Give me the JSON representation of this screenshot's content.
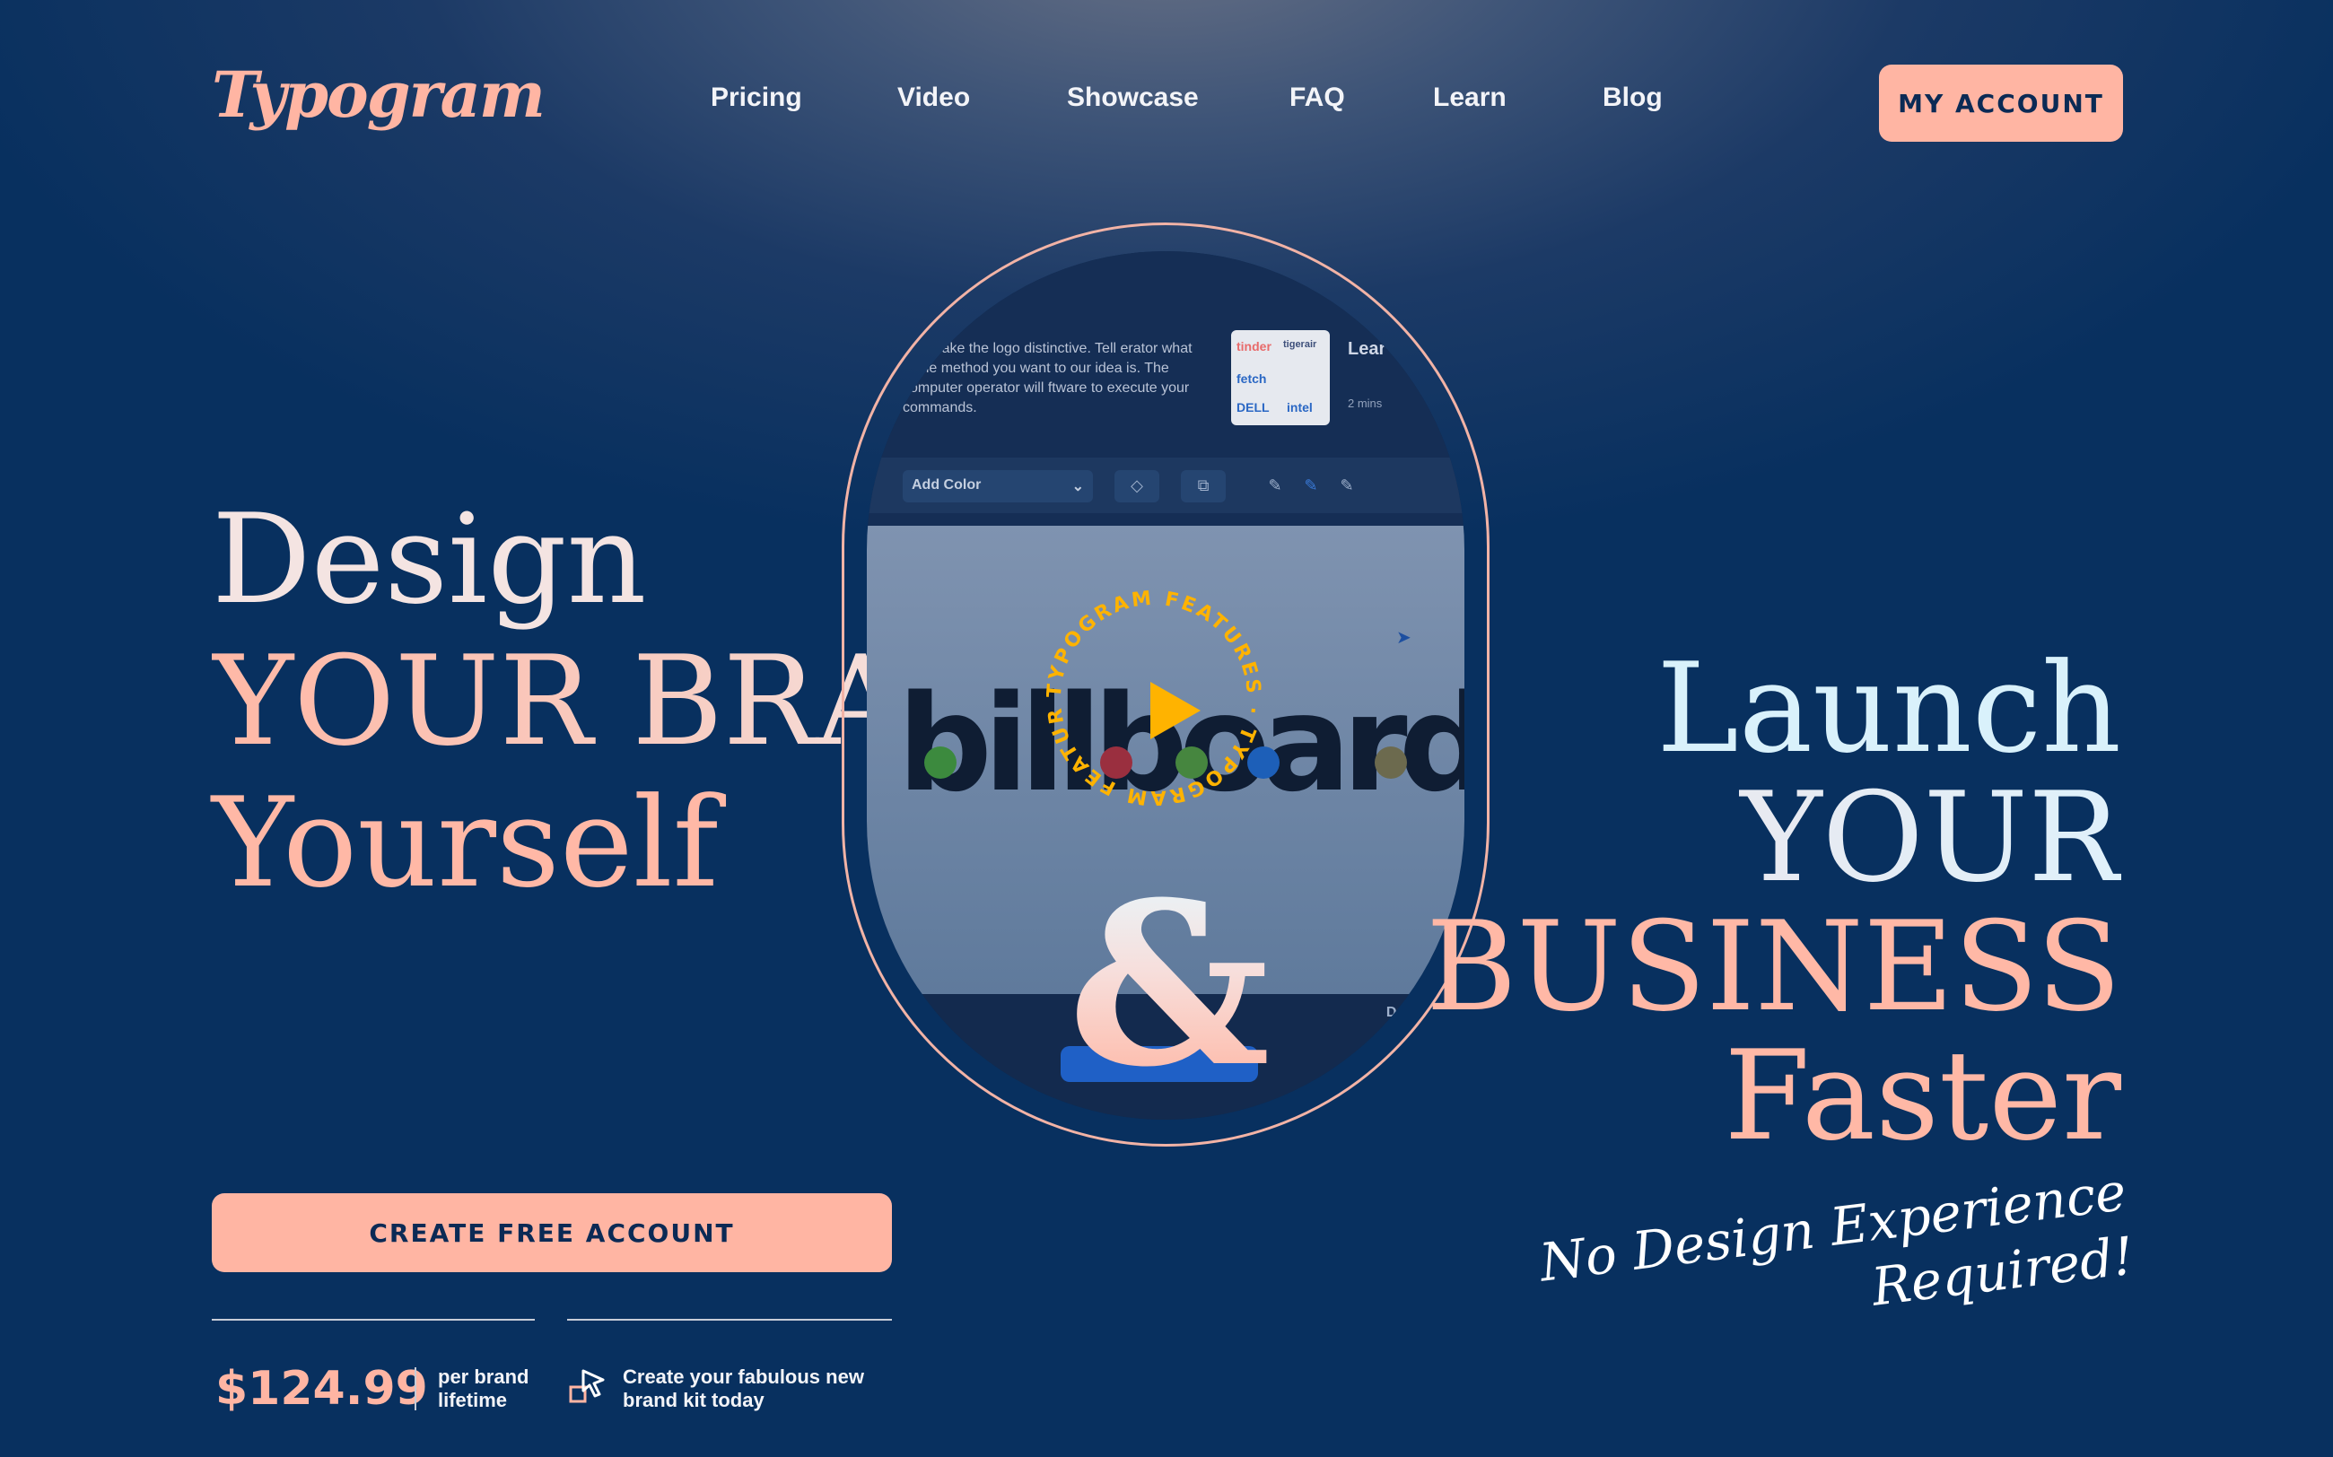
{
  "header": {
    "logo": "Typogram",
    "nav": [
      "Pricing",
      "Video",
      "Showcase",
      "FAQ",
      "Learn",
      "Blog"
    ],
    "account_button": "MY ACCOUNT"
  },
  "hero_left": {
    "line1": "Design",
    "line2": "YOUR BRAND",
    "line3": "Yourself"
  },
  "hero_right": {
    "line1": "Launch",
    "line2": "YOUR",
    "line3": "BUSINESS",
    "line4": "Faster",
    "tagline1": "No Design Experience",
    "tagline2": "Required!"
  },
  "video_preview": {
    "description": "s to make the logo distinctive. Tell erator what is the method you want to our idea is. The computer operator will ftware to execute your commands.",
    "thumb_brands": [
      "tinder",
      "tigerair",
      "fetch",
      "DELL",
      "intel"
    ],
    "learn_title": "Lear Distin",
    "learn_duration": "2 mins",
    "color_select": "Add Color",
    "canvas_logo": "billboard",
    "badge_text": "TYPOGRAM FEATURES · TYPOGRAM FEATURES ·",
    "bottom_label": "Dup",
    "ampersand": "&",
    "dot_colors": [
      "#3c8a3e",
      "#9a2f3f",
      "#46863f",
      "#1d5fb8",
      "#6c6a4e"
    ],
    "accent_colors": {
      "play": "#ffb300",
      "badge_text": "#ffb300"
    }
  },
  "cta": {
    "button": "CREATE FREE ACCOUNT",
    "price": "$124.99",
    "price_note1": "per brand",
    "price_note2": "lifetime",
    "kit_note1": "Create your fabulous new",
    "kit_note2": "brand kit today"
  },
  "colors": {
    "accent": "#ffb5a3",
    "background": "#08305f",
    "button_text": "#0b2a55"
  }
}
